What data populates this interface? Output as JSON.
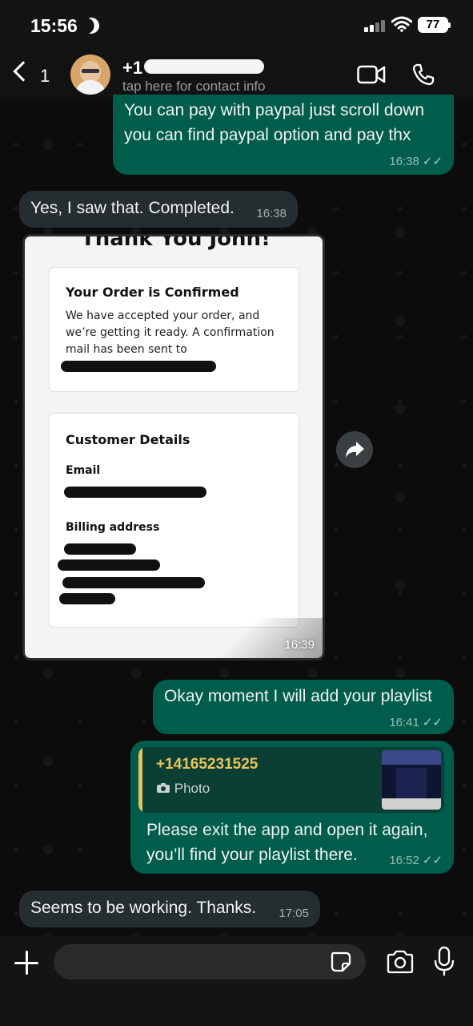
{
  "status_bar": {
    "time": "15:56",
    "battery": "77"
  },
  "header": {
    "back_count": "1",
    "contact_name": "+1",
    "contact_sub": "tap here for contact info"
  },
  "messages": [
    {
      "direction": "out",
      "text_lines": [
        "You can pay with paypal just scroll down",
        "you can find paypal option and pay thx"
      ],
      "time": "16:38",
      "ticks": "✓✓"
    },
    {
      "direction": "in",
      "text": "Yes, I saw that. Completed.",
      "time": "16:38"
    },
    {
      "direction": "in",
      "type": "image",
      "time": "16:39",
      "image": {
        "heading": "Thank You John!",
        "order_title": "Your Order is Confirmed",
        "order_text_lines": [
          "We have accepted your order, and",
          "we’re getting it ready. A confirmation",
          "mail has been sent to"
        ],
        "customer_title": "Customer Details",
        "email_label": "Email",
        "billing_label": "Billing address"
      }
    },
    {
      "direction": "out",
      "text": "Okay moment I will add your playlist",
      "time": "16:41",
      "ticks": "✓✓"
    },
    {
      "direction": "out",
      "reply_to": {
        "name": "+14165231525",
        "kind": "Photo"
      },
      "text_lines": [
        "Please exit the app and open it again,",
        "you’ll find your playlist there."
      ],
      "time": "16:52",
      "ticks": "✓✓"
    },
    {
      "direction": "in",
      "text": "Seems to be working. Thanks.",
      "time": "17:05"
    }
  ],
  "composer": {
    "placeholder": ""
  },
  "colors": {
    "outgoing": "#005c4b",
    "incoming": "#262d31",
    "quote_accent": "#e6c45c"
  }
}
